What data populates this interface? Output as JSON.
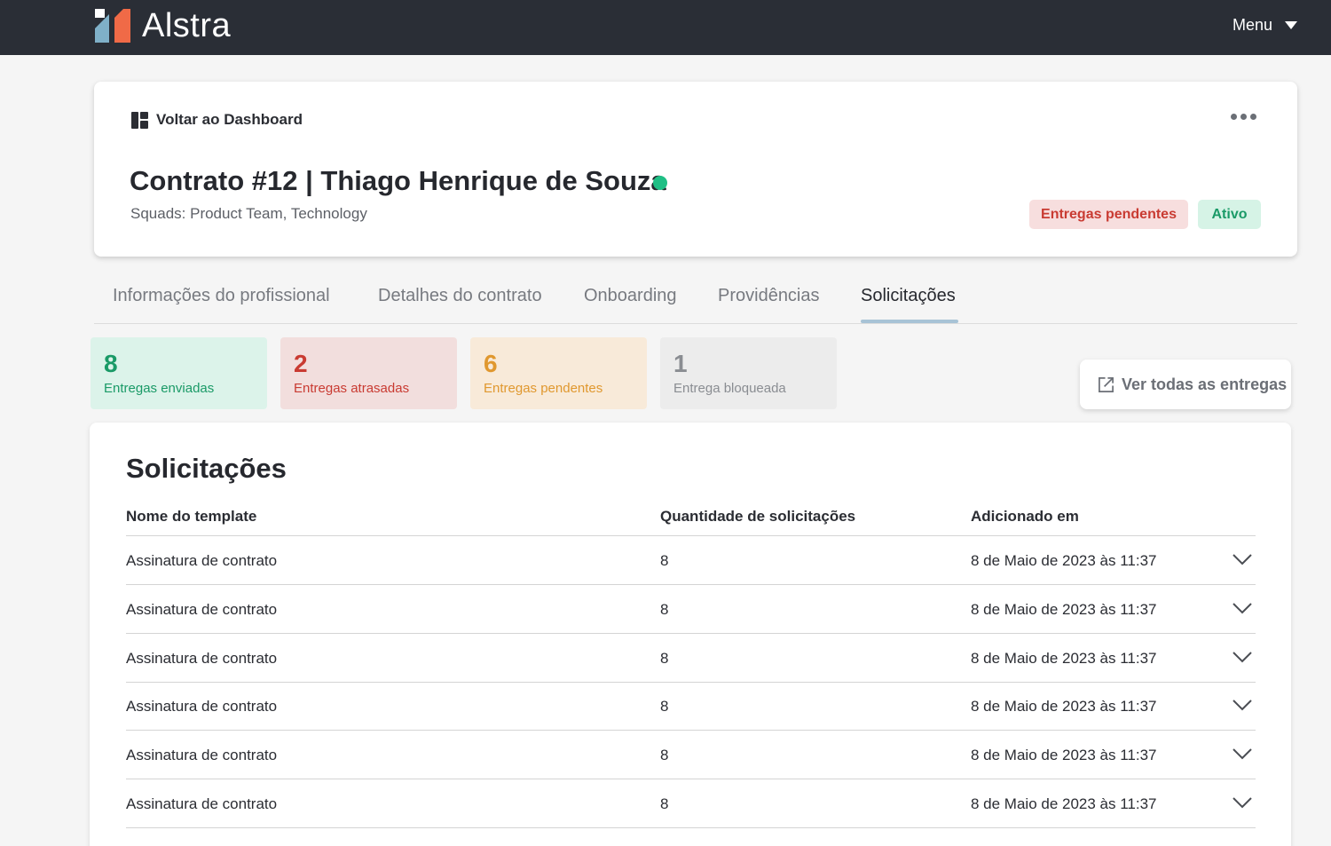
{
  "app": {
    "name": "Alstra",
    "menu_label": "Menu",
    "brand_colors": {
      "dark": "#2a2e36",
      "logo_blue": "#7fb0c8",
      "logo_orange": "#f06a47"
    }
  },
  "header": {
    "back_label": "Voltar ao Dashboard",
    "title": "Contrato #12 | Thiago Henrique de Souza",
    "squads": "Squads: Product Team, Technology",
    "badges": [
      {
        "label": "Entregas pendentes",
        "color": "#c93b32"
      },
      {
        "label": "Ativo",
        "color": "#1a9a67"
      }
    ]
  },
  "tabs": [
    {
      "label": "Informações do profissional",
      "active": false
    },
    {
      "label": "Detalhes do contrato",
      "active": false
    },
    {
      "label": "Onboarding",
      "active": false
    },
    {
      "label": "Providências",
      "active": false
    },
    {
      "label": "Solicitações",
      "active": true
    }
  ],
  "stats": [
    {
      "value": "8",
      "label": "Entregas enviadas"
    },
    {
      "value": "2",
      "label": "Entregas atrasadas"
    },
    {
      "value": "6",
      "label": "Entregas pendentes"
    },
    {
      "value": "1",
      "label": "Entrega bloqueada"
    }
  ],
  "view_all_label": "Ver todas as entregas",
  "requests": {
    "title": "Solicitações",
    "columns": [
      "Nome do template",
      "Quantidade de solicitações",
      "Adicionado em"
    ],
    "rows": [
      {
        "name": "Assinatura de contrato",
        "count": "8",
        "added": "8 de Maio de 2023 às 11:37"
      },
      {
        "name": "Assinatura de contrato",
        "count": "8",
        "added": "8 de Maio de 2023 às 11:37"
      },
      {
        "name": "Assinatura de contrato",
        "count": "8",
        "added": "8 de Maio de 2023 às 11:37"
      },
      {
        "name": "Assinatura de contrato",
        "count": "8",
        "added": "8 de Maio de 2023 às 11:37"
      },
      {
        "name": "Assinatura de contrato",
        "count": "8",
        "added": "8 de Maio de 2023 às 11:37"
      },
      {
        "name": "Assinatura de contrato",
        "count": "8",
        "added": "8 de Maio de 2023 às 11:37"
      }
    ]
  }
}
